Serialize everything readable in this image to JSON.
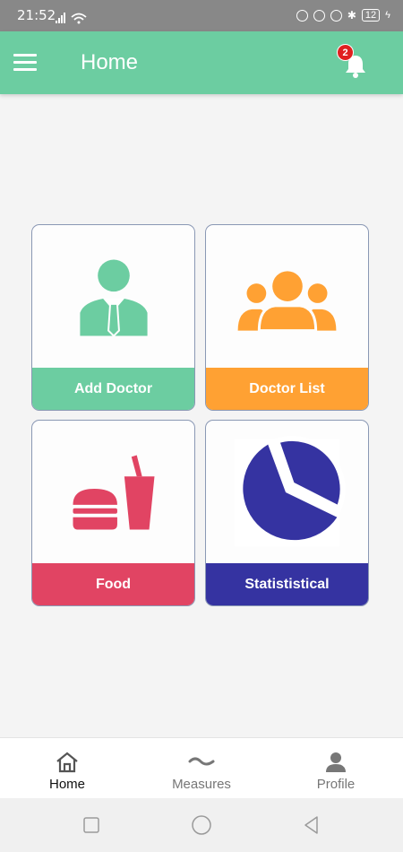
{
  "status_bar": {
    "time": "21:52",
    "battery": "12"
  },
  "header": {
    "title": "Home",
    "notification_count": "2"
  },
  "cards": [
    {
      "label": "Add Doctor",
      "color": "#6ccda1",
      "icon": "doctor-icon"
    },
    {
      "label": "Doctor List",
      "color": "#ffa133",
      "icon": "group-icon"
    },
    {
      "label": "Food",
      "color": "#e14463",
      "icon": "fast-food-icon"
    },
    {
      "label": "Statististical",
      "color": "#3533a1",
      "icon": "pie-chart-icon"
    }
  ],
  "bottom_nav": [
    {
      "label": "Home",
      "icon": "home-icon",
      "active": true
    },
    {
      "label": "Measures",
      "icon": "wave-icon",
      "active": false
    },
    {
      "label": "Profile",
      "icon": "person-icon",
      "active": false
    }
  ]
}
